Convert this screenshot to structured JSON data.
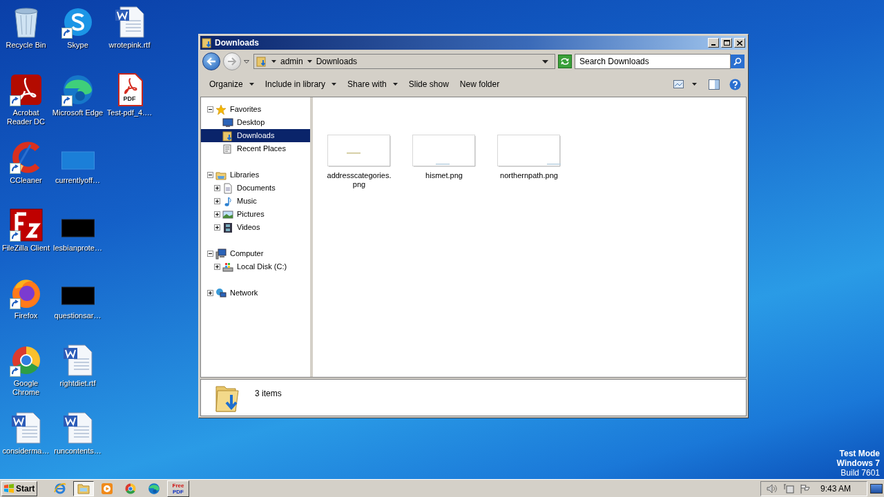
{
  "desktop": {
    "columns": [
      [
        {
          "label": [
            "Recycle Bin"
          ],
          "kind": "recyclebin",
          "shortcut": false
        },
        {
          "label": [
            "Acrobat",
            "Reader DC"
          ],
          "kind": "acrobat",
          "shortcut": true
        },
        {
          "label": [
            "CCleaner"
          ],
          "kind": "ccleaner",
          "shortcut": true
        },
        {
          "label": [
            "FileZilla Client"
          ],
          "kind": "filezilla",
          "shortcut": true
        },
        {
          "label": [
            "Firefox"
          ],
          "kind": "firefox",
          "shortcut": true
        },
        {
          "label": [
            "Google",
            "Chrome"
          ],
          "kind": "chrome",
          "shortcut": true
        },
        {
          "label": [
            "considerma…"
          ],
          "kind": "word",
          "shortcut": false
        }
      ],
      [
        {
          "label": [
            "Skype"
          ],
          "kind": "skype",
          "shortcut": true
        },
        {
          "label": [
            "Microsoft Edge"
          ],
          "kind": "edge",
          "shortcut": true
        },
        {
          "label": [
            "currentlyoff…"
          ],
          "kind": "thumbnail",
          "dark": false,
          "shortcut": false
        },
        {
          "label": [
            "lesbianprote…"
          ],
          "kind": "thumbnail",
          "dark": true,
          "shortcut": false
        },
        {
          "label": [
            "questionsar…"
          ],
          "kind": "thumbnail",
          "dark": true,
          "shortcut": false
        },
        {
          "label": [
            "rightdiet.rtf"
          ],
          "kind": "word",
          "shortcut": false
        },
        {
          "label": [
            "runcontents…"
          ],
          "kind": "word",
          "shortcut": false
        }
      ],
      [
        {
          "label": [
            "wrotepink.rtf"
          ],
          "kind": "word",
          "shortcut": false
        },
        {
          "label": [
            "Test-pdf_4.…"
          ],
          "kind": "pdf",
          "badge": "PDF",
          "shortcut": false
        }
      ]
    ]
  },
  "window": {
    "title": "Downloads",
    "breadcrumb": [
      "admin",
      "Downloads"
    ],
    "search": {
      "placeholder": "Search Downloads"
    },
    "toolbar": [
      {
        "label": "Organize",
        "dropdown": true
      },
      {
        "label": "Include in library",
        "dropdown": true
      },
      {
        "label": "Share with",
        "dropdown": true
      },
      {
        "label": "Slide show",
        "dropdown": false
      },
      {
        "label": "New folder",
        "dropdown": false
      }
    ],
    "nav": [
      {
        "label": "Favorites",
        "kind": "star",
        "expanded": true,
        "selected": false,
        "children": [
          {
            "label": "Desktop",
            "kind": "desktop",
            "selected": false
          },
          {
            "label": "Downloads",
            "kind": "downloads",
            "selected": true
          },
          {
            "label": "Recent Places",
            "kind": "recent",
            "selected": false
          }
        ]
      },
      {
        "label": "Libraries",
        "kind": "library",
        "expanded": true,
        "selected": false,
        "children": [
          {
            "label": "Documents",
            "kind": "documents",
            "expanded": false,
            "selected": false
          },
          {
            "label": "Music",
            "kind": "music",
            "expanded": false,
            "selected": false
          },
          {
            "label": "Pictures",
            "kind": "pictures",
            "expanded": false,
            "selected": false
          },
          {
            "label": "Videos",
            "kind": "videos",
            "expanded": false,
            "selected": false
          }
        ]
      },
      {
        "label": "Computer",
        "kind": "computer",
        "expanded": true,
        "selected": false,
        "children": [
          {
            "label": "Local Disk (C:)",
            "kind": "disk",
            "expanded": false,
            "selected": false
          }
        ]
      },
      {
        "label": "Network",
        "kind": "network",
        "expanded": false,
        "selected": false
      }
    ],
    "files": [
      {
        "name": "addresscategories.png"
      },
      {
        "name": "hismet.png"
      },
      {
        "name": "northernpath.png"
      }
    ],
    "status": "3 items"
  },
  "desktop_note": [
    {
      "text": "Test Mode",
      "bold": true
    },
    {
      "text": "Windows 7",
      "bold": true
    },
    {
      "text": "Build 7601",
      "bold": false
    }
  ],
  "taskbar": {
    "start": "Start",
    "apps": [
      {
        "kind": "ie",
        "selected": false
      },
      {
        "kind": "explorer",
        "selected": true
      },
      {
        "kind": "media",
        "selected": false
      },
      {
        "kind": "chrome",
        "selected": false
      },
      {
        "kind": "edge",
        "selected": false
      },
      {
        "kind": "freepdf",
        "label": [
          "Free",
          "PDF"
        ],
        "selected": false
      }
    ],
    "clock": "9:43 AM"
  }
}
